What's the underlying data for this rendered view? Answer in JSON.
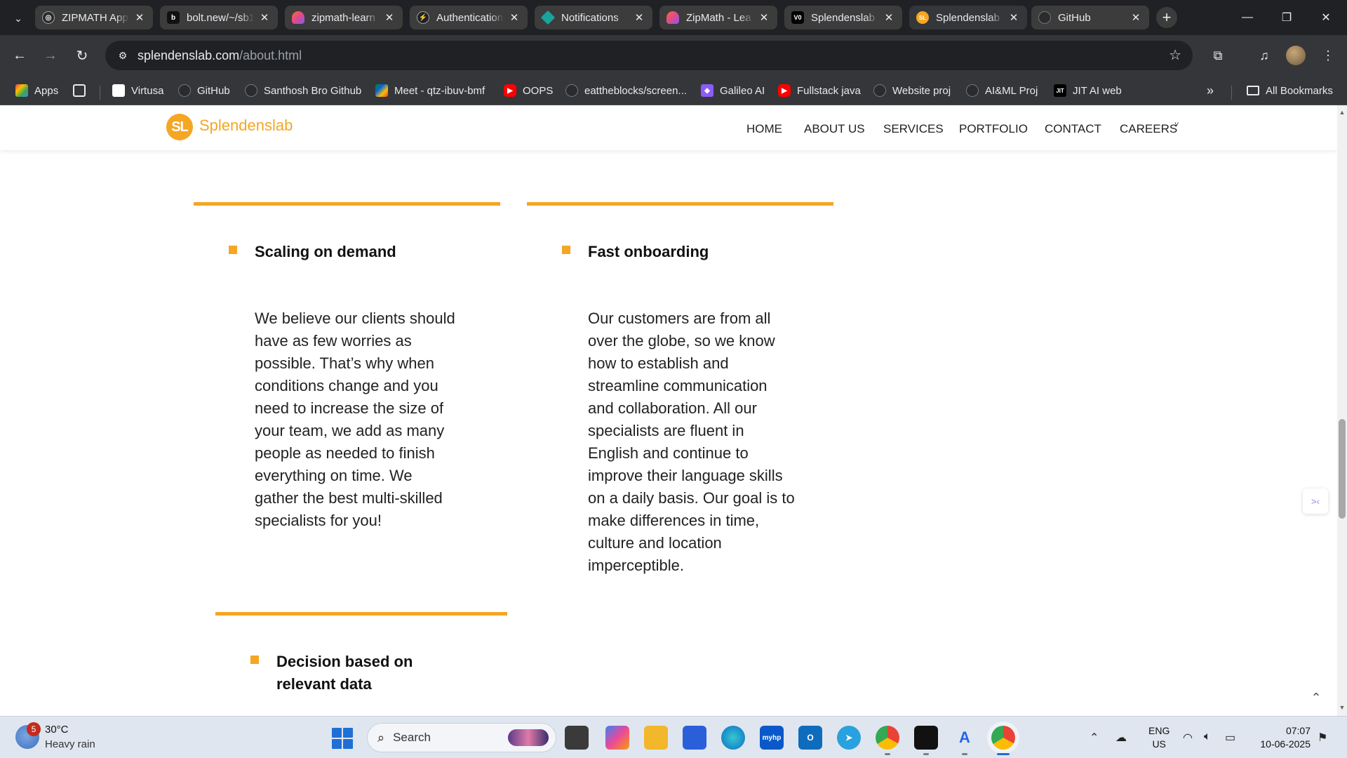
{
  "browser": {
    "tabs": [
      {
        "title": "ZIPMATH App",
        "icon": "openai-icon",
        "color": "#2b2b2b"
      },
      {
        "title": "bolt.new/~/sb1",
        "icon": "bolt-icon",
        "color": "#111111"
      },
      {
        "title": "zipmath-learn",
        "icon": "lovable-icon",
        "color": "#e2498a"
      },
      {
        "title": "Authentication",
        "icon": "supabase-icon",
        "color": "#3ecf8e"
      },
      {
        "title": "Notifications",
        "icon": "diamond-icon",
        "color": "#1aa39a"
      },
      {
        "title": "ZipMath - Lea",
        "icon": "lovable-icon",
        "color": "#e2498a"
      },
      {
        "title": "Splendenslab",
        "icon": "vercel-icon",
        "color": "#000000"
      },
      {
        "title": "Splendenslab",
        "icon": "splendenslab-icon",
        "color": "#f5a623"
      },
      {
        "title": "GitHub",
        "icon": "github-icon",
        "color": "#24292e"
      }
    ],
    "active_tab_index": 7,
    "url_host": "splendenslab.com",
    "url_path": "/about.html",
    "bookmarks": [
      {
        "label": "Apps",
        "icon": "apps-grid-icon"
      },
      {
        "label": "",
        "icon": "grid-icon"
      },
      {
        "label": "Virtusa",
        "icon": "virtusa-icon"
      },
      {
        "label": "GitHub",
        "icon": "github-icon"
      },
      {
        "label": "Santhosh Bro Github",
        "icon": "github-icon"
      },
      {
        "label": "Meet - qtz-ibuv-bmf",
        "icon": "meet-icon"
      },
      {
        "label": "OOPS",
        "icon": "youtube-icon"
      },
      {
        "label": "eattheblocks/screen...",
        "icon": "github-icon"
      },
      {
        "label": "Galileo AI",
        "icon": "galileo-icon"
      },
      {
        "label": "Fullstack java",
        "icon": "youtube-icon"
      },
      {
        "label": "Website proj",
        "icon": "github-icon"
      },
      {
        "label": "AI&ML Proj",
        "icon": "github-icon"
      },
      {
        "label": "JIT AI web",
        "icon": "jit-icon"
      }
    ],
    "all_bookmarks": "All Bookmarks"
  },
  "site": {
    "logo_mark": "SL",
    "logo_text": "Splendenslab",
    "brand_color": "#f5a623",
    "nav": [
      "HOME",
      "ABOUT US",
      "SERVICES",
      "PORTFOLIO",
      "CONTACT",
      "CAREERS"
    ]
  },
  "features": [
    {
      "title": "Scaling on demand",
      "text": [
        "We believe our clients should",
        "have as few worries as",
        "possible. That’s why when",
        "conditions change and you",
        "need to increase the size of",
        "your team, we add as many",
        "people as needed to finish",
        "everything on time. We",
        "gather the best multi-skilled",
        "specialists for you!"
      ]
    },
    {
      "title": "Fast onboarding",
      "text": [
        "Our customers are from all",
        "over the globe, so we know",
        "how to establish and",
        "streamline communication",
        "and collaboration. All our",
        "specialists are fluent in",
        "English and continue to",
        "improve their language skills",
        "on a daily basis. Our goal is to",
        "make differences in time,",
        "culture and location",
        "imperceptible."
      ]
    },
    {
      "title_lines": [
        "Decision based on",
        "relevant data"
      ]
    }
  ],
  "taskbar": {
    "weather_badge": "5",
    "temperature": "30°C",
    "weather": "Heavy rain",
    "search_label": "Search",
    "lang_top": "ENG",
    "lang_bottom": "US",
    "time": "07:07",
    "date": "10-06-2025"
  }
}
